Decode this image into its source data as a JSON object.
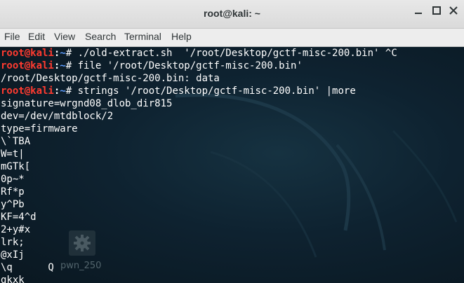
{
  "window": {
    "title": "root@kali: ~"
  },
  "menu": [
    "File",
    "Edit",
    "View",
    "Search",
    "Terminal",
    "Help"
  ],
  "desktop_icon": {
    "label": "pwn_250",
    "icon": "gear-icon"
  },
  "prompt": {
    "user": "root@kali",
    "sep": ":",
    "path": "~",
    "symbol": "# "
  },
  "lines": [
    {
      "type": "cmd",
      "text": "./old-extract.sh  '/root/Desktop/gctf-misc-200.bin' ^C"
    },
    {
      "type": "cmd",
      "text": "file '/root/Desktop/gctf-misc-200.bin'"
    },
    {
      "type": "out",
      "text": "/root/Desktop/gctf-misc-200.bin: data"
    },
    {
      "type": "cmd",
      "text": "strings '/root/Desktop/gctf-misc-200.bin' |more"
    },
    {
      "type": "out",
      "text": "signature=wrgnd08_dlob_dir815"
    },
    {
      "type": "out",
      "text": "dev=/dev/mtdblock/2"
    },
    {
      "type": "out",
      "text": "type=firmware"
    },
    {
      "type": "out",
      "text": "\\`TBA"
    },
    {
      "type": "out",
      "text": "W=t|"
    },
    {
      "type": "out",
      "text": "mGTk["
    },
    {
      "type": "out",
      "text": "0p~*"
    },
    {
      "type": "out",
      "text": "Rf*p"
    },
    {
      "type": "out",
      "text": "y^Pb"
    },
    {
      "type": "out",
      "text": "KF=4^d"
    },
    {
      "type": "out",
      "text": "2+y#x"
    },
    {
      "type": "out",
      "text": "lrk;"
    },
    {
      "type": "out",
      "text": "@xIj"
    },
    {
      "type": "out",
      "text": "\\q      Q"
    },
    {
      "type": "out",
      "text": "gkxk"
    }
  ],
  "colors": {
    "prompt_user": "#ff3b30",
    "prompt_path": "#5c9cff",
    "text": "#ffffff",
    "background": "#0d1a22"
  }
}
